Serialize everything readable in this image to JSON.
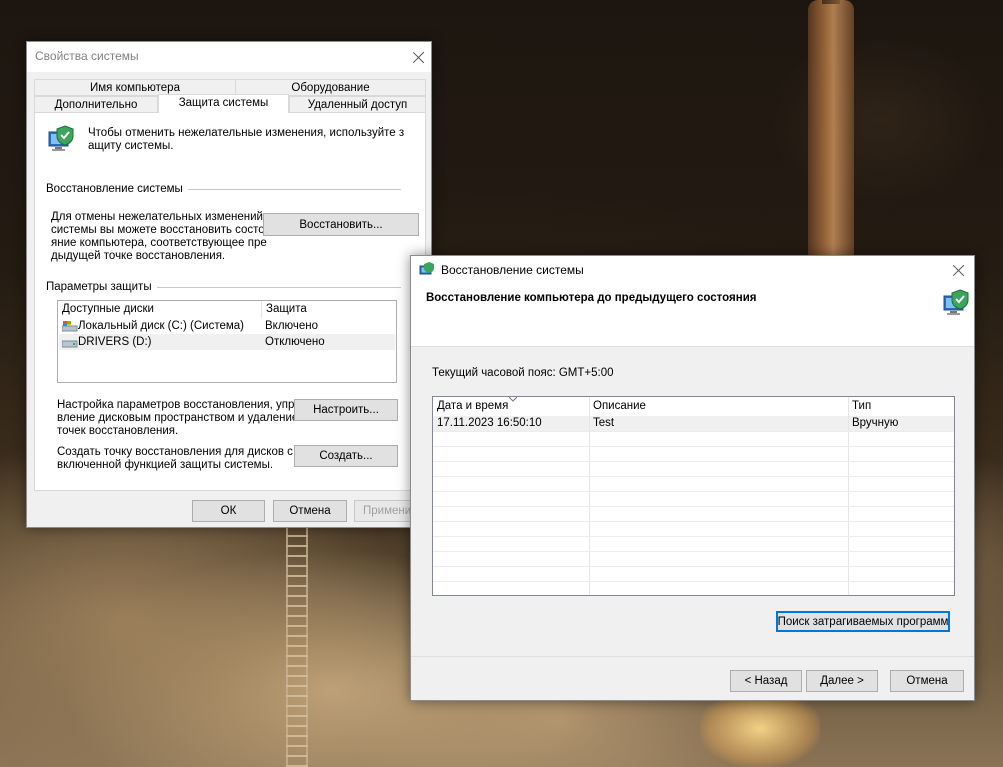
{
  "sysprops": {
    "title": "Свойства системы",
    "tabs_row1": [
      "Имя компьютера",
      "Оборудование"
    ],
    "tabs_row2": [
      "Дополнительно",
      "Защита системы",
      "Удаленный доступ"
    ],
    "active_tab": "Защита системы",
    "intro_line1": "Чтобы отменить нежелательные изменения, используйте з",
    "intro_line2": "ащиту системы.",
    "restore_group": "Восстановление системы",
    "restore_desc": [
      "Для отмены нежелательных изменений",
      "системы вы можете восстановить состо",
      "яние компьютера, соответствующее пре",
      "дыдущей точке восстановления."
    ],
    "restore_button": "Восстановить...",
    "protection_group": "Параметры защиты",
    "drives_header": {
      "drives": "Доступные диски",
      "protection": "Защита"
    },
    "drives": [
      {
        "name": "Локальный диск (C:) (Система)",
        "protection": "Включено",
        "icon": "system-drive-icon"
      },
      {
        "name": "DRIVERS (D:)",
        "protection": "Отключено",
        "icon": "drive-icon"
      }
    ],
    "configure_desc": [
      "Настройка параметров восстановления, упра",
      "вление дисковым пространством и удаление",
      "точек восстановления."
    ],
    "configure_button": "Настроить...",
    "create_desc": [
      "Создать точку восстановления для дисков с",
      "включенной функцией защиты системы."
    ],
    "create_button": "Создать...",
    "ok_button": "ОК",
    "cancel_button": "Отмена",
    "apply_button": "Применить"
  },
  "wizard": {
    "title": "Восстановление системы",
    "heading": "Восстановление компьютера до предыдущего состояния",
    "timezone": "Текущий часовой пояс: GMT+5:00",
    "columns": [
      "Дата и время",
      "Описание",
      "Тип"
    ],
    "rows": [
      {
        "date": "17.11.2023 16:50:10",
        "description": "Test",
        "type": "Вручную"
      }
    ],
    "scan_button": "Поиск затрагиваемых программ",
    "back_button": "< Назад",
    "next_button": "Далее >",
    "cancel_button": "Отмена"
  },
  "colors": {
    "window_bg": "#f0f0f0",
    "focus_accent": "#0078d7"
  }
}
